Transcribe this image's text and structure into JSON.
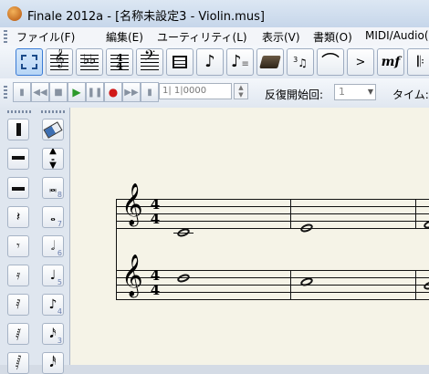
{
  "window": {
    "title": "Finale 2012a - [名称未設定3 - Violin.mus]"
  },
  "menu": [
    "ファイル(F)",
    "編集(E)",
    "ユーティリティ(L)",
    "表示(V)",
    "書類(O)",
    "MIDI/Audio("
  ],
  "main_tools": [
    {
      "name": "selection-tool",
      "selected": true
    },
    {
      "name": "staff-tool"
    },
    {
      "name": "key-signature-tool"
    },
    {
      "name": "time-signature-tool"
    },
    {
      "name": "clef-tool"
    },
    {
      "name": "measure-tool"
    },
    {
      "name": "simple-entry-tool"
    },
    {
      "name": "speedy-entry-tool"
    },
    {
      "name": "hyperscribe-tool"
    },
    {
      "name": "tuplet-tool"
    },
    {
      "name": "smart-shape-tool"
    },
    {
      "name": "articulation-tool"
    },
    {
      "name": "expression-tool"
    },
    {
      "name": "repeat-tool"
    }
  ],
  "playback": {
    "counter": "1| 1|0000",
    "repeat_label": "反復開始回:",
    "repeat_value": "1",
    "time_label": "タイム:"
  },
  "palette_rests": {
    "subscripts": []
  },
  "palette_notes": {
    "subscripts": [
      "8",
      "7",
      "6",
      "5",
      "4",
      "3"
    ]
  },
  "score": {
    "time_signature": {
      "numerator": "4",
      "denominator": "4"
    },
    "staves": 2,
    "measures_visible": 3
  },
  "colors": {
    "score_paper": "#f5f3e7",
    "selection_accent": "#3a7bd5",
    "play_green": "#2c9a2c",
    "record_red": "#d01818"
  }
}
